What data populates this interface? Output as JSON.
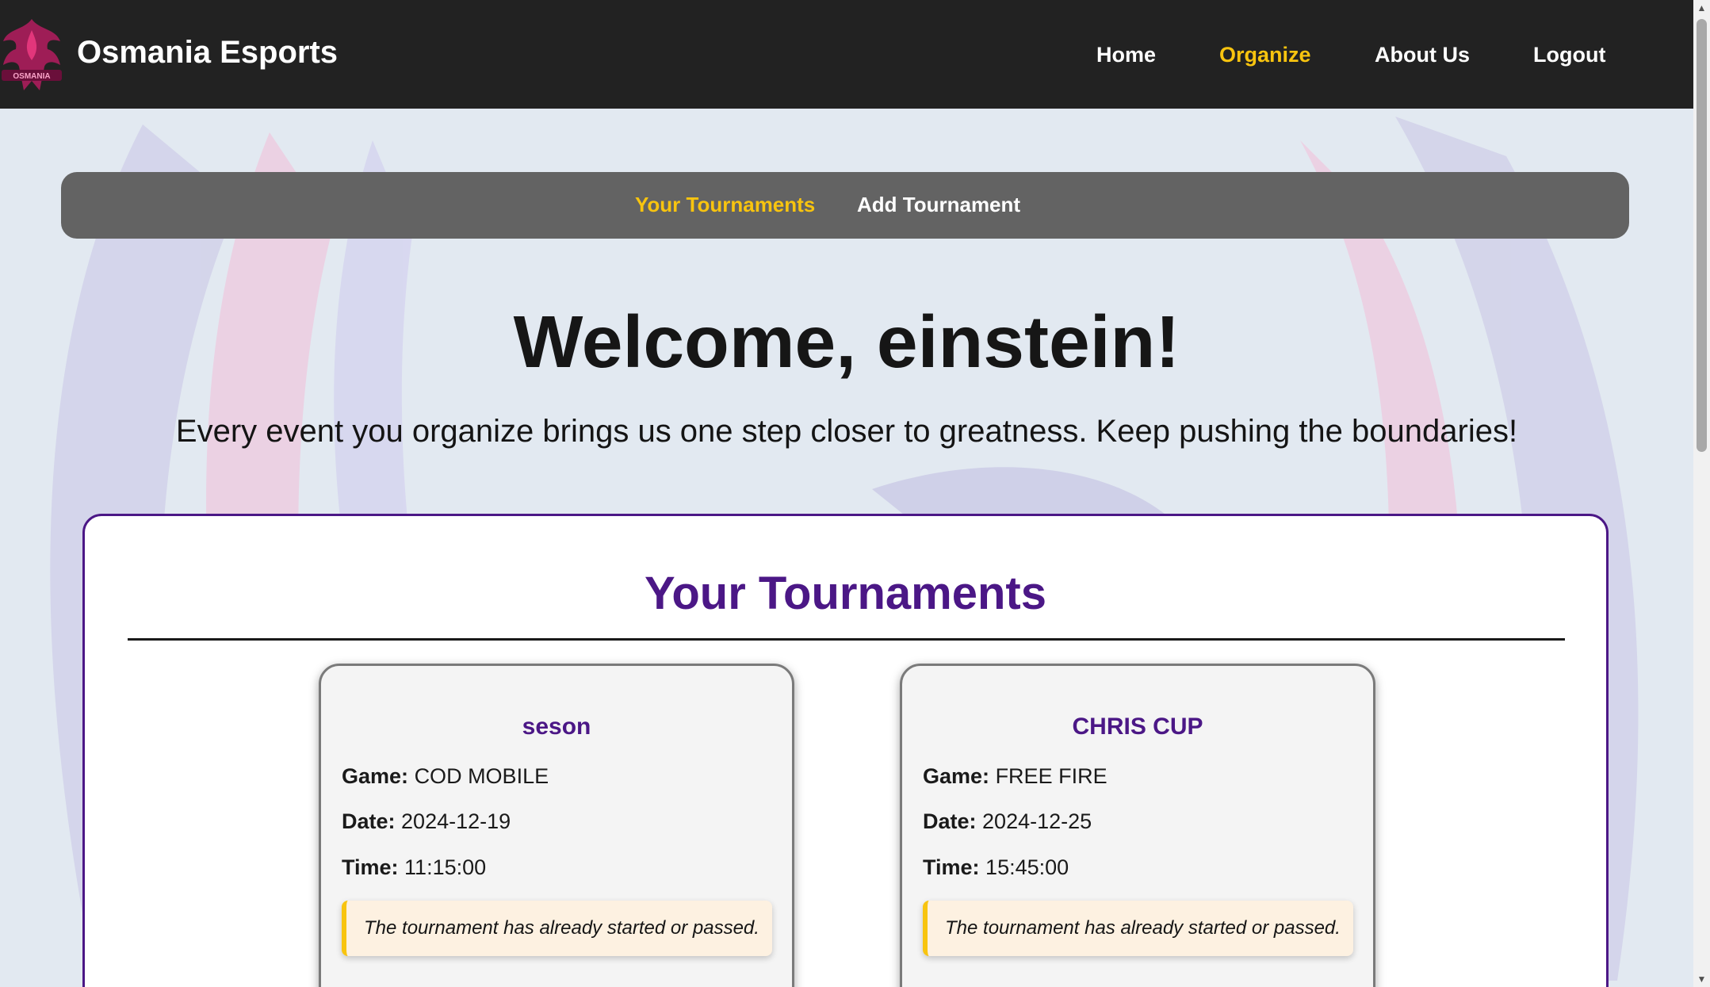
{
  "brand": {
    "name": "Osmania Esports",
    "logo_text": "OSMANIA"
  },
  "nav": {
    "items": [
      {
        "label": "Home",
        "active": false
      },
      {
        "label": "Organize",
        "active": true
      },
      {
        "label": "About Us",
        "active": false
      },
      {
        "label": "Logout",
        "active": false
      }
    ]
  },
  "subnav": {
    "items": [
      {
        "label": "Your Tournaments",
        "active": true
      },
      {
        "label": "Add Tournament",
        "active": false
      }
    ]
  },
  "welcome": {
    "heading": "Welcome, einstein!",
    "tagline": "Every event you organize brings us one step closer to greatness. Keep pushing the boundaries!"
  },
  "tournaments_panel": {
    "title": "Your Tournaments",
    "field_labels": {
      "game": "Game:",
      "date": "Date:",
      "time": "Time:"
    },
    "cards": [
      {
        "name": "seson",
        "game": "COD MOBILE",
        "date": "2024-12-19",
        "time": "11:15:00",
        "notice": "The tournament has already started or passed."
      },
      {
        "name": "CHRIS CUP",
        "game": "FREE FIRE",
        "date": "2024-12-25",
        "time": "15:45:00",
        "notice": "The tournament has already started or passed."
      }
    ]
  },
  "colors": {
    "navbar": "#222222",
    "accent_yellow": "#f8c40f",
    "accent_purple": "#4b1786",
    "background": "#e2e9f1"
  },
  "icons": {
    "logo": "phoenix-logo-icon",
    "scroll_up": "scroll-up-arrow-icon",
    "scroll_down": "scroll-down-arrow-icon"
  }
}
